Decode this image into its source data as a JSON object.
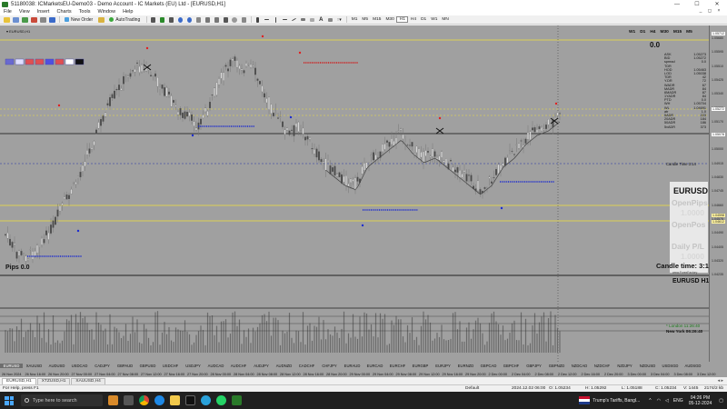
{
  "window": {
    "title": "51180038: ICMarketsEU-Demo03 - Demo Account - IC Markets (EU) Ltd - [EURUSD,H1]",
    "controls": [
      "—",
      "☐",
      "✕"
    ]
  },
  "menu": [
    "File",
    "View",
    "Insert",
    "Charts",
    "Tools",
    "Window",
    "Help"
  ],
  "mdi_controls": [
    "_",
    "◻",
    "×"
  ],
  "toolbar": {
    "new_order": "New Order",
    "auto_trading": "AutoTrading",
    "timeframes": [
      "M1",
      "M5",
      "M15",
      "M30",
      "H1",
      "H4",
      "D1",
      "W1",
      "MN"
    ]
  },
  "chart": {
    "symbol_label": "▾ EURUSD,H1",
    "tf_labels": [
      "W1",
      "D1",
      "H4",
      "M30",
      "M15",
      "M5"
    ],
    "info_big": "0.0",
    "info_rows": [
      [
        "ASK",
        "1.05273"
      ],
      [
        "BID",
        "1.05272"
      ],
      [
        "spread",
        "0.0"
      ],
      [
        "TDR",
        ""
      ],
      [
        "HOD",
        "1.05463"
      ],
      [
        "LOD",
        "1.05038"
      ],
      [
        "TDR",
        "42"
      ],
      [
        "Y.DR",
        "72"
      ],
      [
        "WADR",
        "67"
      ],
      [
        "MADR",
        "84"
      ],
      [
        "6MADR",
        "87"
      ],
      [
        "1YADR",
        "84"
      ],
      [
        "PTD",
        "0.0"
      ],
      [
        "WH",
        "1.05704"
      ],
      [
        "WL",
        "1.04691"
      ],
      [
        "atr",
        "1.0"
      ],
      [
        "5ADR",
        "223"
      ],
      [
        "20ADR",
        "184"
      ],
      [
        "50ADR",
        "186"
      ],
      [
        "5vADR",
        "373"
      ]
    ],
    "candle_time_small": "Candle Time   3:14",
    "big_symbol": "EURUSD",
    "faded_lines": [
      "OpenPips",
      "1.0000",
      "OpenPos",
      "Daily P/L",
      "1.0000"
    ],
    "candle_time": "Candle time:  3:13",
    "site": "www.ForexFactory",
    "pips": "Pips 0.0",
    "sub_symbol": "EURUSD  H1",
    "london": "* London   11:26:40",
    "newyork": "New York  06:26:40",
    "symbol_strip": [
      "EURUSD",
      "XAUUSD",
      "AUDUSD",
      "USDCAD",
      "CADJPY",
      "GBPAUD",
      "GBPUSD",
      "USDCHF",
      "USDJPY",
      "AUDCAD",
      "AUDCHF",
      "AUDJPY",
      "AUDNZD",
      "CADCHF",
      "CHFJPY",
      "EURAUD",
      "EURCAD",
      "EURCHF",
      "EURGBP",
      "EURJPY",
      "EURNZD",
      "GBPCAD",
      "GBPCHF",
      "GBPJPY",
      "GBPNZD",
      "NZDCAD",
      "NZDCHF",
      "NZDJPY",
      "NZDUSD",
      "USDSGD",
      "AUDSGD"
    ],
    "price_axis": [
      "1.05680",
      "1.05595",
      "1.05510",
      "1.05425",
      "1.05340",
      "1.05255",
      "1.05170",
      "1.05085",
      "1.05000",
      "1.04915",
      "1.04830",
      "1.04745",
      "1.04660",
      "1.04575",
      "1.04490",
      "1.04405",
      "1.04320",
      "1.04235"
    ],
    "price_box_labels": [
      "1.05712",
      "1.05272",
      "1.05078",
      "1.04598",
      "1.04612"
    ],
    "time_axis": [
      "26 Nov 2024",
      "26 Nov 16:00",
      "26 Nov 20:00",
      "27 Nov 00:00",
      "27 Nov 04:00",
      "27 Nov 08:00",
      "27 Nov 12:00",
      "27 Nov 16:00",
      "27 Nov 20:00",
      "28 Nov 00:00",
      "28 Nov 04:00",
      "28 Nov 08:00",
      "28 Nov 12:00",
      "28 Nov 16:00",
      "28 Nov 20:00",
      "29 Nov 00:00",
      "29 Nov 04:00",
      "29 Nov 08:00",
      "29 Nov 12:00",
      "29 Nov 16:00",
      "29 Nov 20:00",
      "2 Dec 00:00",
      "2 Dec 04:00",
      "2 Dec 08:00",
      "2 Dec 12:00",
      "2 Dec 16:00",
      "2 Dec 20:00",
      "3 Dec 00:00",
      "3 Dec 04:00",
      "3 Dec 08:00",
      "3 Dec 12:00"
    ]
  },
  "tabs": [
    "EURUSD,H1",
    "XTZUSD,H1",
    "XAUUSD,H4"
  ],
  "status": {
    "help": "For Help, press F1",
    "profile": "Default",
    "time": "2024.12.02 06:00",
    "open": "O: 1.05234",
    "high": "H: 1.05292",
    "low": "L: 1.05188",
    "close": "C: 1.05234",
    "volume": "V: 1445",
    "traffic": "2174/2 kb"
  },
  "taskbar": {
    "search_placeholder": "Type here to search",
    "news": "Trump's Tariffs, Bangl...",
    "lang": "ENG",
    "time": "04:26 PM",
    "date": "05-12-2024"
  }
}
